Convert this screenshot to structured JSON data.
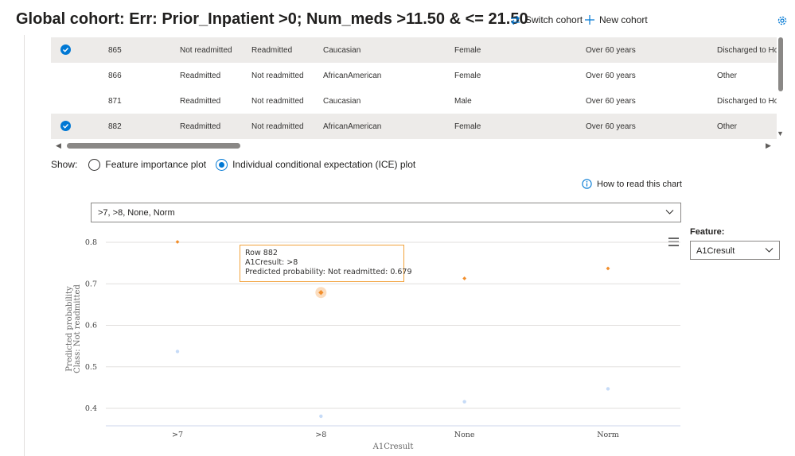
{
  "header": {
    "title": "Global cohort: Err: Prior_Inpatient >0; Num_meds >11.50 & <= 21.50",
    "switch_cohort": "Switch cohort",
    "new_cohort": "New cohort"
  },
  "table": {
    "rows": [
      {
        "selected": true,
        "index": "865",
        "c1": "Not readmitted",
        "c2": "Readmitted",
        "race": "Caucasian",
        "gender": "Female",
        "age": "Over 60 years",
        "disch": "Discharged to Hon"
      },
      {
        "selected": false,
        "index": "866",
        "c1": "Readmitted",
        "c2": "Not readmitted",
        "race": "AfricanAmerican",
        "gender": "Female",
        "age": "Over 60 years",
        "disch": "Other"
      },
      {
        "selected": false,
        "index": "871",
        "c1": "Readmitted",
        "c2": "Not readmitted",
        "race": "Caucasian",
        "gender": "Male",
        "age": "Over 60 years",
        "disch": "Discharged to Hon"
      },
      {
        "selected": true,
        "index": "882",
        "c1": "Readmitted",
        "c2": "Not readmitted",
        "race": "AfricanAmerican",
        "gender": "Female",
        "age": "Over 60 years",
        "disch": "Other"
      }
    ]
  },
  "show": {
    "label": "Show:",
    "options": [
      "Feature importance plot",
      "Individual conditional expectation (ICE) plot"
    ],
    "selected": 1
  },
  "how_to_read": "How to read this chart",
  "value_filter": ">7, >8, None, Norm",
  "feature": {
    "label": "Feature:",
    "value": "A1Cresult"
  },
  "tooltip": {
    "line1": "Row 882",
    "line2": "A1Cresult: >8",
    "line3": "Predicted probability: Not readmitted: 0.679"
  },
  "colors": {
    "accent": "#0078d4",
    "series_selected": "#f28e2b",
    "series_other": "#c6dbf7",
    "grid": "#e1dfdd"
  },
  "chart_data": {
    "type": "scatter",
    "categories": [
      ">7",
      ">8",
      "None",
      "Norm"
    ],
    "xlabel": "A1Cresult",
    "ylabel_line1": "Predicted probability",
    "ylabel_line2": "Class: Not readmitted",
    "yticks": [
      "0.8",
      "0.7",
      "0.6",
      "0.5",
      "0.4"
    ],
    "ylim": [
      0.36,
      0.82
    ],
    "series": [
      {
        "color": "#f28e2b",
        "values": [
          0.801,
          0.679,
          0.713,
          0.737
        ],
        "highlight_index": 1
      },
      {
        "color": "#c6dbf7",
        "values": [
          0.537,
          0.381,
          0.416,
          0.447
        ]
      }
    ]
  }
}
